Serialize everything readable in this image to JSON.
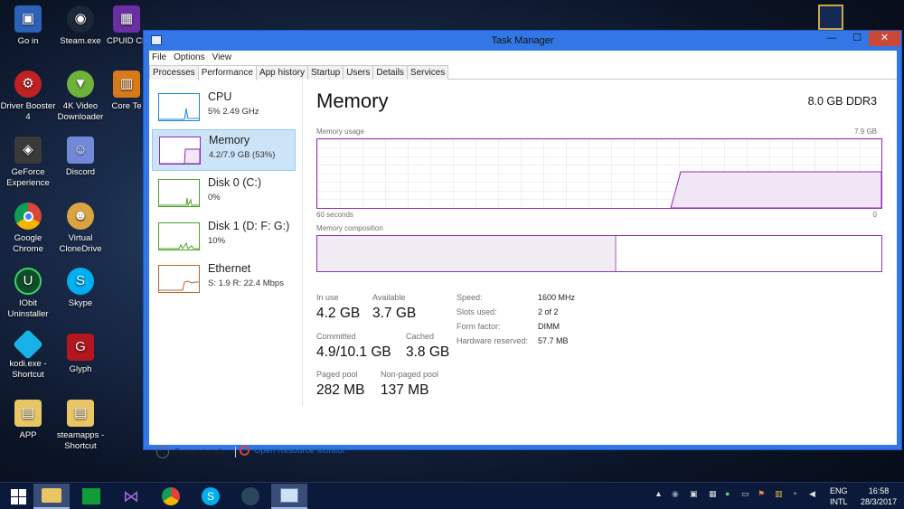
{
  "desktop": {
    "icons": [
      {
        "label": "Go in"
      },
      {
        "label": "Steam.exe"
      },
      {
        "label": "CPUID CP"
      },
      {
        "label": "Driver Booster 4"
      },
      {
        "label": "4K Video Downloader"
      },
      {
        "label": "Core Te"
      },
      {
        "label": "GeForce Experience"
      },
      {
        "label": "Discord"
      },
      {
        "label": "Google Chrome"
      },
      {
        "label": "Virtual CloneDrive"
      },
      {
        "label": "IObit Uninstaller"
      },
      {
        "label": "Skype"
      },
      {
        "label": "kodi.exe - Shortcut"
      },
      {
        "label": "Glyph"
      },
      {
        "label": "APP"
      },
      {
        "label": "steamapps - Shortcut"
      }
    ]
  },
  "window": {
    "title": "Task Manager",
    "minimize": "—",
    "maximize": "☐",
    "close": "✕"
  },
  "menu": [
    "File",
    "Options",
    "View"
  ],
  "tabs": [
    "Processes",
    "Performance",
    "App history",
    "Startup",
    "Users",
    "Details",
    "Services"
  ],
  "perf_list": [
    {
      "name": "CPU",
      "sub": "5%  2.49 GHz",
      "color": "#1a8ad4"
    },
    {
      "name": "Memory",
      "sub": "4.2/7.9 GB (53%)",
      "color": "#8b2bb0"
    },
    {
      "name": "Disk 0 (C:)",
      "sub": "0%",
      "color": "#4aa323"
    },
    {
      "name": "Disk 1 (D: F: G:)",
      "sub": "10%",
      "color": "#4aa323"
    },
    {
      "name": "Ethernet",
      "sub": "S: 1.9  R: 22.4 Mbps",
      "color": "#b8652a"
    }
  ],
  "memory": {
    "title": "Memory",
    "spec": "8.0 GB DDR3",
    "usage_label": "Memory usage",
    "usage_max": "7.9 GB",
    "time_left": "60 seconds",
    "time_right": "0",
    "composition_label": "Memory composition",
    "in_use_fraction": 0.53,
    "stats": {
      "in_use_label": "In use",
      "in_use": "4.2 GB",
      "available_label": "Available",
      "available": "3.7 GB",
      "committed_label": "Committed",
      "committed": "4.9/10.1 GB",
      "cached_label": "Cached",
      "cached": "3.8 GB",
      "paged_label": "Paged pool",
      "paged": "282 MB",
      "nonpaged_label": "Non-paged pool",
      "nonpaged": "137 MB"
    },
    "kv": {
      "speed_label": "Speed:",
      "speed": "1600 MHz",
      "slots_label": "Slots used:",
      "slots": "2 of 2",
      "form_label": "Form factor:",
      "form": "DIMM",
      "reserved_label": "Hardware reserved:",
      "reserved": "57.7 MB"
    }
  },
  "footer": {
    "fewer_details": "Fewer details",
    "resource_monitor": "Open Resource Monitor"
  },
  "taskbar": {
    "lang_top": "ENG",
    "lang_bottom": "INTL",
    "time": "16:58",
    "date": "28/3/2017"
  },
  "colors": {
    "memory_accent": "#8b2bb0",
    "window_border": "#3377e6",
    "close_button": "#c9483a"
  }
}
